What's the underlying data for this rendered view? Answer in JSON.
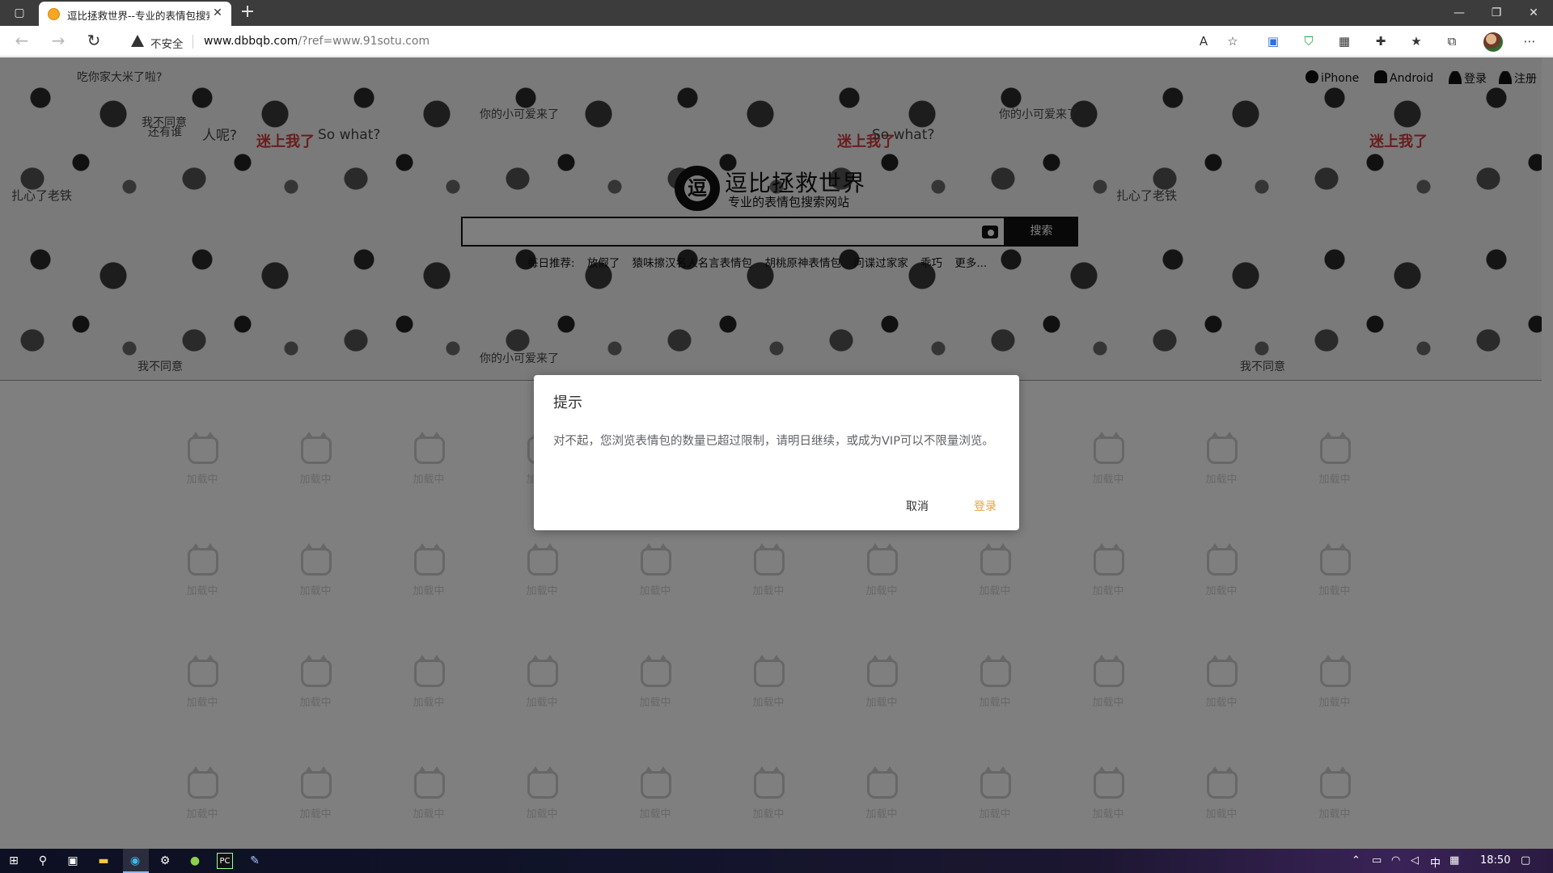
{
  "browser": {
    "tab_title": "逗比拯救世界--专业的表情包搜索",
    "tab_close": "✕",
    "new_tab": "+",
    "security_label": "不安全",
    "url_host": "www.dbbqb.com",
    "url_path": "/?ref=www.91sotu.com",
    "window_controls": {
      "minimize": "—",
      "restore": "❐",
      "close": "✕"
    }
  },
  "site": {
    "title": "逗比拯救世界",
    "subtitle": "专业的表情包搜索网站",
    "logo_char": "逗",
    "nav": {
      "iphone": "iPhone",
      "android": "Android",
      "login": "登录",
      "register": "注册"
    },
    "search": {
      "placeholder": "",
      "button": "搜索"
    },
    "recommend": {
      "label": "每日推荐:",
      "items": [
        "放假了",
        "猿味擦汉名人名言表情包",
        "胡桃原神表情包",
        "问谍过家家",
        "乖巧",
        "更多..."
      ]
    },
    "banner_text": [
      "吃你家大米了啦?",
      "我不同意",
      "你的小可爱来了",
      "迷上我了",
      "So what?",
      "扎心了老铁",
      "还有谁",
      "人呢?"
    ],
    "placeholder_text": "加载中"
  },
  "dialog": {
    "title": "提示",
    "message": "对不起，您浏览表情包的数量已超过限制，请明日继续，或成为VIP可以不限量浏览。",
    "cancel": "取消",
    "login": "登录"
  },
  "taskbar": {
    "ime": "中",
    "time": "18:50"
  }
}
